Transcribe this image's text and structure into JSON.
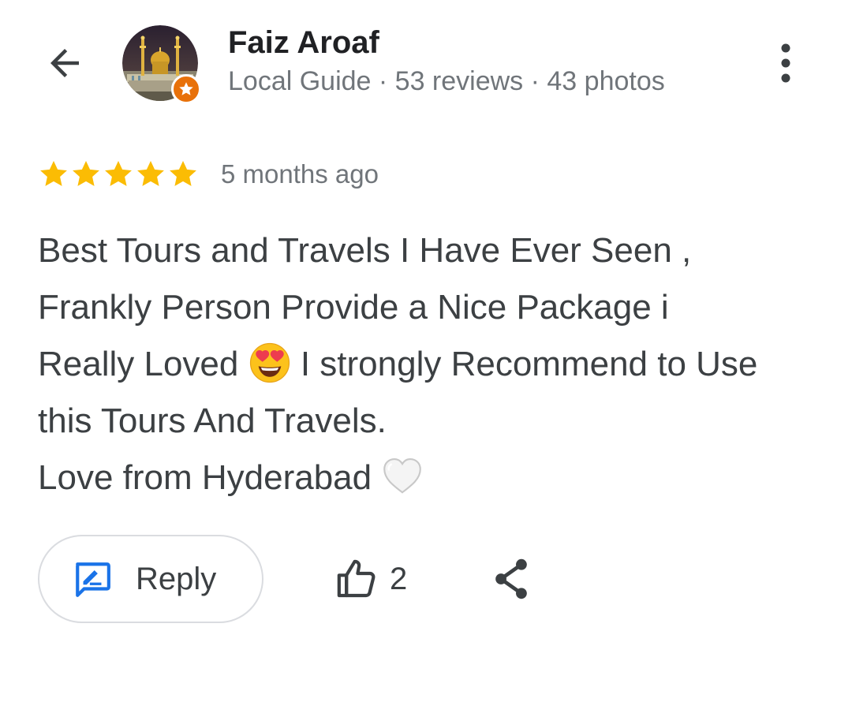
{
  "header": {
    "reviewer_name": "Faiz Aroaf",
    "reviewer_meta": "Local Guide · 53 reviews · 43 photos"
  },
  "review": {
    "rating": 5,
    "max_rating": 5,
    "time_ago": "5 months ago",
    "lines": [
      {
        "before": "Best Tours and Travels I Have Ever Seen ,",
        "after": ""
      },
      {
        "before": "Frankly Person Provide a Nice Package i",
        "after": ""
      },
      {
        "before": "Really Loved ",
        "after": " I strongly Recommend to Use"
      },
      {
        "before": "this Tours And Travels.",
        "after": ""
      },
      {
        "before": "Love from Hyderabad ",
        "after": ""
      }
    ]
  },
  "actions": {
    "reply_label": "Reply",
    "like_count": "2"
  },
  "icons": {
    "back": "arrow-back-icon",
    "more": "more-vert-icon",
    "star": "star-icon",
    "reply": "reply-edit-icon",
    "like": "thumb-up-icon",
    "share": "share-icon",
    "heart_eyes": "smiling-face-with-heart-eyes-emoji",
    "white_heart": "white-heart-emoji",
    "badge": "local-guide-star-badge-icon"
  },
  "colors": {
    "star": "#fbbc04",
    "reply_icon": "#1a73e8",
    "badge": "#e8710a",
    "text": "#3c4043",
    "muted": "#70757a"
  }
}
